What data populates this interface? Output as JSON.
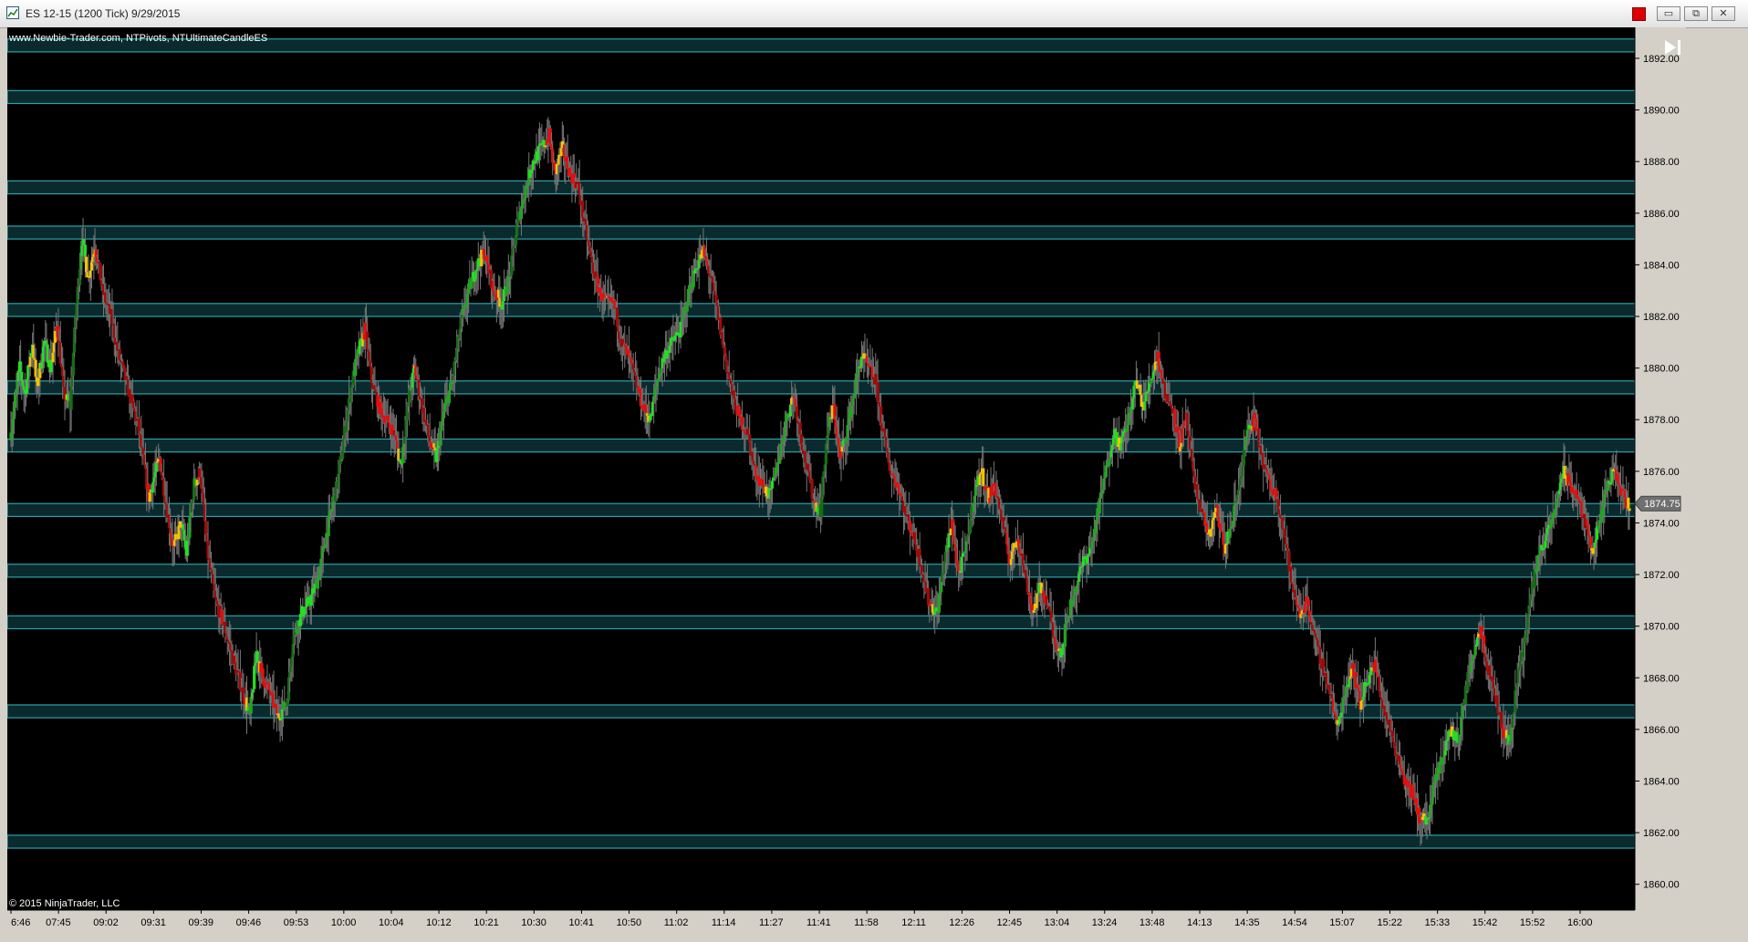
{
  "window": {
    "title": "ES 12-15 (1200 Tick)  9/29/2015",
    "buttons": [
      "▭",
      "⧉",
      "✕"
    ]
  },
  "chart_data": {
    "type": "candlestick",
    "indicators_label": "www.Newbie-Trader.com, NTPivots, NTUltimateCandleES",
    "copyright": "© 2015 NinjaTrader, LLC",
    "current_price_label": "1874.75",
    "current_price": 1874.75,
    "ylim": [
      1859.0,
      1893.2
    ],
    "y_ticks": [
      1860,
      1862,
      1864,
      1866,
      1868,
      1870,
      1872,
      1874,
      1876,
      1878,
      1880,
      1882,
      1884,
      1886,
      1888,
      1890,
      1892
    ],
    "y_tick_labels": [
      "1860.00",
      "1862.00",
      "1864.00",
      "1866.00",
      "1868.00",
      "1870.00",
      "1872.00",
      "1874.00",
      "1876.00",
      "1878.00",
      "1880.00",
      "1882.00",
      "1884.00",
      "1886.00",
      "1888.00",
      "1890.00",
      "1892.00"
    ],
    "x_tick_labels": [
      "6:46",
      "07:45",
      "09:02",
      "09:31",
      "09:39",
      "09:46",
      "09:53",
      "10:00",
      "10:04",
      "10:12",
      "10:21",
      "10:30",
      "10:41",
      "10:50",
      "11:02",
      "11:14",
      "11:27",
      "11:41",
      "11:58",
      "12:11",
      "12:26",
      "12:45",
      "13:04",
      "13:24",
      "13:48",
      "14:13",
      "14:35",
      "14:54",
      "15:07",
      "15:22",
      "15:33",
      "15:42",
      "15:52",
      "16:00"
    ],
    "pivot_bands": [
      [
        1892.25,
        1892.75
      ],
      [
        1890.25,
        1890.75
      ],
      [
        1886.75,
        1887.25
      ],
      [
        1885.0,
        1885.5
      ],
      [
        1882.0,
        1882.5
      ],
      [
        1879.0,
        1879.5
      ],
      [
        1876.75,
        1877.25
      ],
      [
        1874.25,
        1874.75
      ],
      [
        1871.9,
        1872.4
      ],
      [
        1869.9,
        1870.4
      ],
      [
        1866.45,
        1866.95
      ],
      [
        1861.4,
        1861.9
      ]
    ],
    "price_path": [
      [
        0,
        1877.5
      ],
      [
        8,
        1880.0
      ],
      [
        13,
        1879.0
      ],
      [
        20,
        1881.0
      ],
      [
        24,
        1879.2
      ],
      [
        31,
        1881.0
      ],
      [
        37,
        1880.0
      ],
      [
        43,
        1881.8
      ],
      [
        49,
        1879.0
      ],
      [
        55,
        1878.5
      ],
      [
        60,
        1882.0
      ],
      [
        66,
        1885.0
      ],
      [
        72,
        1883.5
      ],
      [
        78,
        1884.8
      ],
      [
        85,
        1883.0
      ],
      [
        93,
        1882.0
      ],
      [
        100,
        1880.5
      ],
      [
        110,
        1879.0
      ],
      [
        118,
        1877.8
      ],
      [
        128,
        1875.0
      ],
      [
        138,
        1876.5
      ],
      [
        145,
        1874.5
      ],
      [
        151,
        1873.0
      ],
      [
        158,
        1874.0
      ],
      [
        163,
        1872.8
      ],
      [
        170,
        1875.5
      ],
      [
        176,
        1876.0
      ],
      [
        182,
        1873.0
      ],
      [
        190,
        1871.0
      ],
      [
        198,
        1870.0
      ],
      [
        208,
        1868.5
      ],
      [
        215,
        1867.5
      ],
      [
        222,
        1866.5
      ],
      [
        228,
        1869.0
      ],
      [
        234,
        1868.0
      ],
      [
        240,
        1867.5
      ],
      [
        248,
        1866.5
      ],
      [
        256,
        1867.0
      ],
      [
        262,
        1869.5
      ],
      [
        270,
        1870.5
      ],
      [
        278,
        1871.0
      ],
      [
        286,
        1872.0
      ],
      [
        295,
        1874.0
      ],
      [
        303,
        1875.5
      ],
      [
        310,
        1877.5
      ],
      [
        317,
        1879.5
      ],
      [
        322,
        1880.5
      ],
      [
        329,
        1881.5
      ],
      [
        335,
        1879.5
      ],
      [
        342,
        1878.5
      ],
      [
        349,
        1878.0
      ],
      [
        356,
        1877.5
      ],
      [
        362,
        1876.2
      ],
      [
        370,
        1879.0
      ],
      [
        375,
        1880.0
      ],
      [
        382,
        1878.5
      ],
      [
        390,
        1877.0
      ],
      [
        395,
        1876.5
      ],
      [
        403,
        1878.5
      ],
      [
        410,
        1879.5
      ],
      [
        417,
        1881.5
      ],
      [
        425,
        1883.0
      ],
      [
        433,
        1884.0
      ],
      [
        440,
        1884.5
      ],
      [
        448,
        1883.0
      ],
      [
        456,
        1882.5
      ],
      [
        463,
        1883.5
      ],
      [
        470,
        1885.5
      ],
      [
        478,
        1887.0
      ],
      [
        485,
        1888.0
      ],
      [
        492,
        1888.5
      ],
      [
        500,
        1889.0
      ],
      [
        505,
        1887.5
      ],
      [
        512,
        1888.5
      ],
      [
        520,
        1887.5
      ],
      [
        527,
        1887.0
      ],
      [
        533,
        1885.5
      ],
      [
        540,
        1884.0
      ],
      [
        546,
        1883.0
      ],
      [
        553,
        1882.5
      ],
      [
        560,
        1882.5
      ],
      [
        567,
        1881.0
      ],
      [
        573,
        1880.5
      ],
      [
        580,
        1879.5
      ],
      [
        587,
        1878.5
      ],
      [
        594,
        1878.0
      ],
      [
        600,
        1879.5
      ],
      [
        607,
        1880.5
      ],
      [
        614,
        1881.0
      ],
      [
        622,
        1881.5
      ],
      [
        630,
        1883.0
      ],
      [
        637,
        1884.0
      ],
      [
        643,
        1884.5
      ],
      [
        650,
        1883.5
      ],
      [
        657,
        1882.0
      ],
      [
        663,
        1880.5
      ],
      [
        670,
        1879.0
      ],
      [
        677,
        1878.0
      ],
      [
        684,
        1877.5
      ],
      [
        691,
        1876.0
      ],
      [
        698,
        1875.5
      ],
      [
        705,
        1875.0
      ],
      [
        713,
        1876.5
      ],
      [
        720,
        1878.0
      ],
      [
        727,
        1879.0
      ],
      [
        733,
        1877.5
      ],
      [
        740,
        1876.0
      ],
      [
        746,
        1874.8
      ],
      [
        752,
        1874.5
      ],
      [
        758,
        1877.5
      ],
      [
        764,
        1878.5
      ],
      [
        770,
        1876.5
      ],
      [
        776,
        1877.5
      ],
      [
        783,
        1879.0
      ],
      [
        790,
        1880.5
      ],
      [
        796,
        1880.0
      ],
      [
        803,
        1879.5
      ],
      [
        810,
        1877.5
      ],
      [
        817,
        1876.0
      ],
      [
        824,
        1875.5
      ],
      [
        830,
        1874.5
      ],
      [
        838,
        1873.5
      ],
      [
        845,
        1872.5
      ],
      [
        852,
        1871.0
      ],
      [
        860,
        1870.5
      ],
      [
        867,
        1872.5
      ],
      [
        874,
        1874.0
      ],
      [
        880,
        1872.0
      ],
      [
        887,
        1873.0
      ],
      [
        894,
        1875.0
      ],
      [
        901,
        1876.0
      ],
      [
        908,
        1875.0
      ],
      [
        914,
        1875.5
      ],
      [
        921,
        1874.0
      ],
      [
        928,
        1872.5
      ],
      [
        935,
        1873.5
      ],
      [
        942,
        1872.0
      ],
      [
        949,
        1870.5
      ],
      [
        956,
        1871.5
      ],
      [
        962,
        1871.0
      ],
      [
        969,
        1869.5
      ],
      [
        976,
        1869.0
      ],
      [
        982,
        1870.5
      ],
      [
        989,
        1871.5
      ],
      [
        996,
        1872.5
      ],
      [
        1003,
        1873.0
      ],
      [
        1010,
        1874.5
      ],
      [
        1017,
        1876.0
      ],
      [
        1024,
        1877.5
      ],
      [
        1031,
        1877.0
      ],
      [
        1038,
        1878.0
      ],
      [
        1045,
        1879.5
      ],
      [
        1052,
        1878.5
      ],
      [
        1058,
        1879.5
      ],
      [
        1065,
        1880.5
      ],
      [
        1072,
        1879.0
      ],
      [
        1079,
        1878.5
      ],
      [
        1085,
        1877.0
      ],
      [
        1092,
        1878.0
      ],
      [
        1099,
        1875.5
      ],
      [
        1106,
        1874.5
      ],
      [
        1113,
        1873.5
      ],
      [
        1120,
        1874.5
      ],
      [
        1127,
        1873.0
      ],
      [
        1134,
        1874.0
      ],
      [
        1141,
        1875.5
      ],
      [
        1148,
        1877.5
      ],
      [
        1155,
        1878.0
      ],
      [
        1162,
        1876.5
      ],
      [
        1169,
        1875.5
      ],
      [
        1176,
        1875.0
      ],
      [
        1183,
        1873.5
      ],
      [
        1190,
        1871.5
      ],
      [
        1197,
        1870.5
      ],
      [
        1204,
        1871.0
      ],
      [
        1211,
        1869.5
      ],
      [
        1218,
        1868.5
      ],
      [
        1225,
        1867.5
      ],
      [
        1232,
        1866.0
      ],
      [
        1239,
        1867.5
      ],
      [
        1246,
        1868.5
      ],
      [
        1253,
        1867.0
      ],
      [
        1260,
        1868.0
      ],
      [
        1267,
        1868.5
      ],
      [
        1274,
        1867.0
      ],
      [
        1281,
        1866.0
      ],
      [
        1288,
        1865.0
      ],
      [
        1295,
        1864.0
      ],
      [
        1302,
        1863.5
      ],
      [
        1309,
        1862.5
      ],
      [
        1316,
        1862.5
      ],
      [
        1323,
        1864.0
      ],
      [
        1330,
        1865.0
      ],
      [
        1337,
        1866.0
      ],
      [
        1344,
        1865.5
      ],
      [
        1351,
        1867.5
      ],
      [
        1358,
        1869.0
      ],
      [
        1365,
        1870.0
      ],
      [
        1371,
        1868.5
      ],
      [
        1378,
        1867.5
      ],
      [
        1385,
        1866.0
      ],
      [
        1392,
        1865.5
      ],
      [
        1399,
        1868.0
      ],
      [
        1406,
        1869.5
      ],
      [
        1413,
        1871.5
      ],
      [
        1420,
        1873.0
      ],
      [
        1427,
        1873.5
      ],
      [
        1434,
        1874.5
      ],
      [
        1441,
        1876.0
      ],
      [
        1448,
        1875.5
      ],
      [
        1455,
        1875.0
      ],
      [
        1462,
        1874.0
      ],
      [
        1469,
        1873.0
      ],
      [
        1476,
        1874.0
      ],
      [
        1483,
        1875.5
      ],
      [
        1490,
        1876.0
      ],
      [
        1497,
        1875.0
      ],
      [
        1503,
        1874.75
      ]
    ]
  }
}
